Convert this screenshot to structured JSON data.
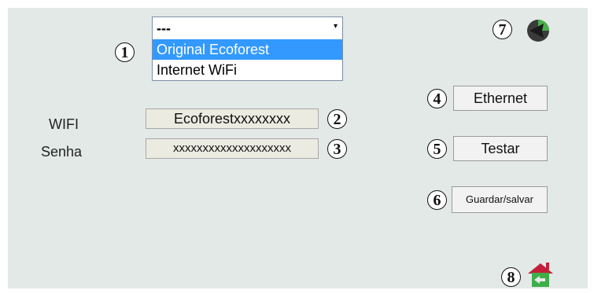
{
  "dropdown": {
    "current": "---",
    "caret": "▾",
    "options": [
      "Original Ecoforest",
      "Internet WiFi"
    ]
  },
  "labels": {
    "wifi": "WIFI",
    "password": "Senha"
  },
  "fields": {
    "ssid": "Ecoforestxxxxxxxx",
    "password": "xxxxxxxxxxxxxxxxxxxx"
  },
  "buttons": {
    "ethernet": "Ethernet",
    "test": "Testar",
    "save": "Guardar/salvar"
  },
  "callouts": [
    "1",
    "2",
    "3",
    "4",
    "5",
    "6",
    "7",
    "8"
  ],
  "icons": {
    "back": "back-arrow-icon",
    "home": "home-icon"
  },
  "colors": {
    "panel": "#e3e9e7",
    "selection": "#3399ff",
    "home_roof": "#c2203a",
    "home_body": "#3fae49"
  }
}
